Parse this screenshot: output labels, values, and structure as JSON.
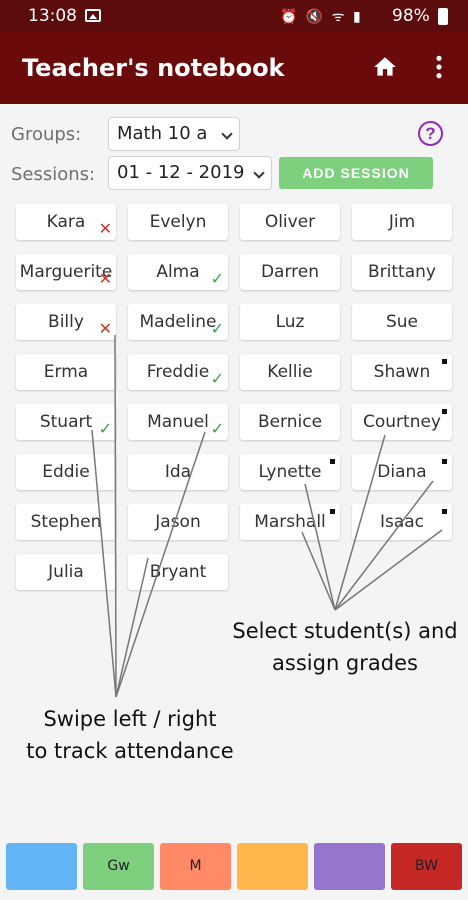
{
  "status": {
    "time": "13:08",
    "battery": "98%",
    "icons": "⏰ 🔇 ᯤ ▮"
  },
  "app": {
    "title": "Teacher's notebook",
    "home_icon": "home-icon",
    "menu_icon": "more-vert-icon"
  },
  "controls": {
    "groups_label": "Groups:",
    "group_value": "Math 10 a",
    "sessions_label": "Sessions:",
    "session_value": "01 - 12 - 2019",
    "add_session_label": "ADD SESSION",
    "help_label": "?"
  },
  "students": [
    {
      "name": "Kara",
      "mark": "absent"
    },
    {
      "name": "Evelyn",
      "mark": ""
    },
    {
      "name": "Oliver",
      "mark": ""
    },
    {
      "name": "Jim",
      "mark": ""
    },
    {
      "name": "Marguerite",
      "mark": "absent"
    },
    {
      "name": "Alma",
      "mark": "present"
    },
    {
      "name": "Darren",
      "mark": ""
    },
    {
      "name": "Brittany",
      "mark": ""
    },
    {
      "name": "Billy",
      "mark": "absent"
    },
    {
      "name": "Madeline",
      "mark": "present"
    },
    {
      "name": "Luz",
      "mark": ""
    },
    {
      "name": "Sue",
      "mark": ""
    },
    {
      "name": "Erma",
      "mark": ""
    },
    {
      "name": "Freddie",
      "mark": "present"
    },
    {
      "name": "Kellie",
      "mark": ""
    },
    {
      "name": "Shawn",
      "mark": "selected"
    },
    {
      "name": "Stuart",
      "mark": "present"
    },
    {
      "name": "Manuel",
      "mark": "present"
    },
    {
      "name": "Bernice",
      "mark": ""
    },
    {
      "name": "Courtney",
      "mark": "selected"
    },
    {
      "name": "Eddie",
      "mark": ""
    },
    {
      "name": "Ida",
      "mark": ""
    },
    {
      "name": "Lynette",
      "mark": "selected"
    },
    {
      "name": "Diana",
      "mark": "selected"
    },
    {
      "name": "Stephen",
      "mark": ""
    },
    {
      "name": "Jason",
      "mark": ""
    },
    {
      "name": "Marshall",
      "mark": "selected"
    },
    {
      "name": "Isaac",
      "mark": "selected"
    },
    {
      "name": "Julia",
      "mark": ""
    },
    {
      "name": "Bryant",
      "mark": ""
    }
  ],
  "annotations": {
    "grades_line1": "Select student(s) and",
    "grades_line2": "assign grades",
    "swipe_line1": "Swipe left / right",
    "swipe_line2": "to track attendance"
  },
  "grade_buttons": [
    {
      "label": "",
      "color": "#64b5f6"
    },
    {
      "label": "Gw",
      "color": "#7ed07e"
    },
    {
      "label": "M",
      "color": "#ff8a65"
    },
    {
      "label": "",
      "color": "#ffb74d"
    },
    {
      "label": "",
      "color": "#9575cd"
    },
    {
      "label": "BW",
      "color": "#c62828"
    }
  ],
  "mark_colors": {
    "absent": "#c0392b",
    "present": "#3aa548",
    "selected": "#111111"
  }
}
